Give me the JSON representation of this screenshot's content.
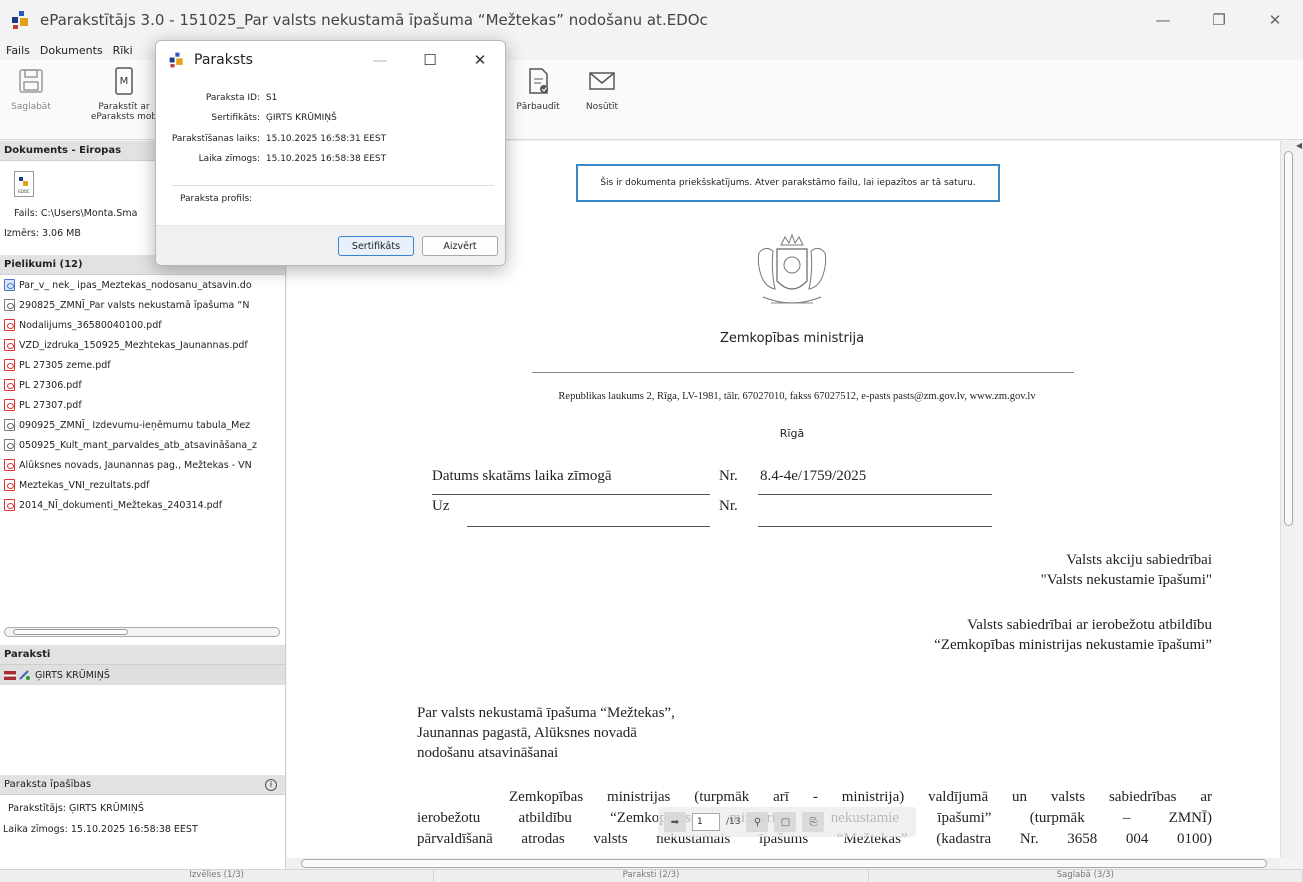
{
  "window": {
    "title": "eParakstītājs 3.0 - 151025_Par valsts nekustamā īpašuma “Mežtekas” nodošanu at.EDOc"
  },
  "menu": [
    "Fails",
    "Dokuments",
    "Rīki"
  ],
  "toolbar": {
    "save": "Saglabāt",
    "sign_mobile_line1": "Parakstīt ar",
    "sign_mobile_line2": "eParaksts mob",
    "verify": "Pārbaudīt",
    "send": "Nosūtīt"
  },
  "left": {
    "document_header": "Dokuments - Eiropas",
    "file_label": "Fails: C:\\Users\\Monta.Sma",
    "size_label": "Izmērs: 3.06 MB",
    "attachments_header": "Pielikumi (12)",
    "attachments": [
      {
        "name": "Par_v_ nek_ ipas_Meztekas_nodosanu_atsavin.do",
        "icon": "link"
      },
      {
        "name": "290825_ZMNĪ_Par valsts nekustamā īpašuma  “N",
        "icon": "doc"
      },
      {
        "name": "Nodalijums_36580040100.pdf",
        "icon": "pdf"
      },
      {
        "name": "VZD_izdruka_150925_Mezhtekas_Jaunannas.pdf",
        "icon": "pdf"
      },
      {
        "name": "PL 27305 zeme.pdf",
        "icon": "pdf"
      },
      {
        "name": "PL 27306.pdf",
        "icon": "pdf"
      },
      {
        "name": "PL 27307.pdf",
        "icon": "pdf"
      },
      {
        "name": "090925_ZMNĪ_ Izdevumu-ieņēmumu tabula_Mez",
        "icon": "doc"
      },
      {
        "name": "050925_Kult_mant_parvaldes_atb_atsavināšana_z",
        "icon": "doc"
      },
      {
        "name": "Alūksnes novads, Jaunannas pag., Mežtekas - VN",
        "icon": "pdf"
      },
      {
        "name": "Meztekas_VNI_rezultats.pdf",
        "icon": "pdf"
      },
      {
        "name": "2014_NĪ_dokumenti_Mežtekas_240314.pdf",
        "icon": "pdf"
      }
    ],
    "signatures_header": "Paraksti",
    "signer": "ĢIRTS KRŪMIŅŠ",
    "props_header": "Paraksta īpašības",
    "props_signer": "Parakstītājs: ĢIRTS KRŪMIŅŠ",
    "props_timestamp": "Laika zīmogs: 15.10.2025 16:58:38 EEST"
  },
  "dialog": {
    "title": "Paraksts",
    "rows": [
      {
        "label": "Paraksta ID:",
        "value": "S1"
      },
      {
        "label": "Sertifikāts:",
        "value": "ĢIRTS KRŪMIŅŠ"
      },
      {
        "label": "Parakstīšanas laiks:",
        "value": "15.10.2025 16:58:31 EEST"
      },
      {
        "label": "Laika zīmogs:",
        "value": "15.10.2025 16:58:38 EEST"
      }
    ],
    "profile_label": "Paraksta profils:",
    "cert_button": "Sertifikāts",
    "close_button": "Aizvērt"
  },
  "document": {
    "preview_note": "Šis ir dokumenta priekšskatījums. Atver parakstāmo failu, lai iepazītos ar tā saturu.",
    "ministry": "Zemkopības ministrija",
    "address": "Republikas laukums 2, Rīga, LV-1981, tālr. 67027010,  fakss 67027512,  e-pasts pasts@zm.gov.lv, www.zm.gov.lv",
    "city": "Rīgā",
    "date_text": "Datums skatāms laika zīmogā",
    "nr_label": "Nr.",
    "nr_value": "8.4-4e/1759/2025",
    "uz_label": "Uz",
    "nr2_label": "Nr.",
    "recipient1_line1": "Valsts akciju sabiedrībai",
    "recipient1_line2": "\"Valsts nekustamie īpašumi\"",
    "recipient2_line1": "Valsts sabiedrībai ar ierobežotu atbildību",
    "recipient2_line2": "“Zemkopības ministrijas nekustamie īpašumi”",
    "subject_line1": "Par valsts nekustamā īpašuma “Mežtekas”,",
    "subject_line2": "Jaunannas pagastā, Alūksnes novadā",
    "subject_line3": "nodošanu atsavināšanai",
    "body_line1": "Zemkopības ministrijas (turpmāk arī - ministrija) valdījumā un valsts sabiedrības ar",
    "body_line2": "ierobežotu atbildību “Zemkopības ministrijas nekustamie īpašumi” (turpmāk – ZMNĪ)",
    "body_line3": "pārvaldīšanā atrodas valsts nekustamais īpašums “Mežtekas” (kadastra Nr. 3658 004 0100)"
  },
  "pager": {
    "page_value": "1",
    "page_total": "/13"
  },
  "status": [
    "Izvēlies (1/3)",
    "Paraksti (2/3)",
    "Saglabā (3/3)"
  ]
}
